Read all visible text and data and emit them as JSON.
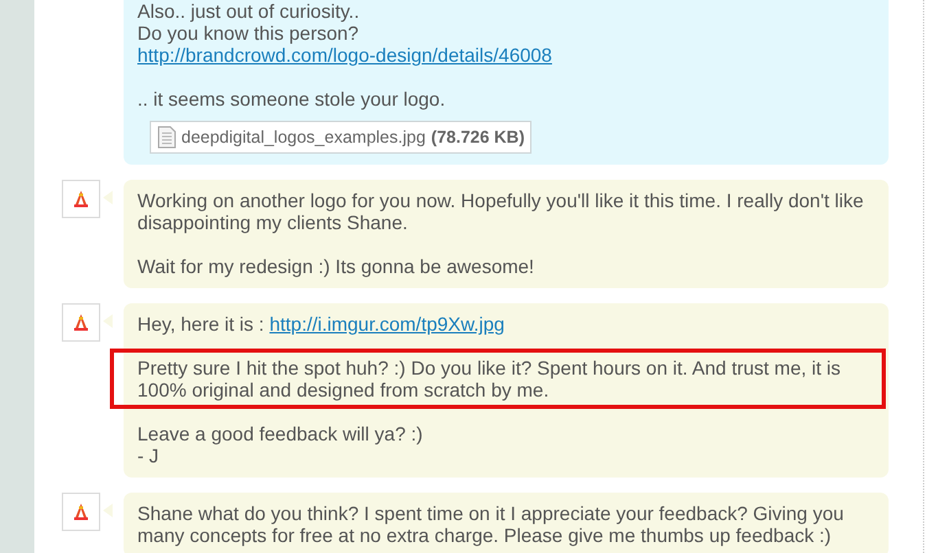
{
  "messages": [
    {
      "kind": "incoming",
      "avatar": false,
      "paragraphs": [
        {
          "highlighted": false,
          "lines": [
            [
              {
                "kind": "text",
                "text": "Also.. just out of curiosity.."
              }
            ],
            [
              {
                "kind": "text",
                "text": "Do you know this person?"
              }
            ],
            [
              {
                "kind": "link",
                "text": "http://brandcrowd.com/logo-design/details/46008"
              }
            ]
          ]
        },
        {
          "highlighted": false,
          "lines": [
            [
              {
                "kind": "text",
                "text": ".. it seems someone stole your logo."
              }
            ]
          ]
        }
      ],
      "attachment": {
        "name": "deepdigital_logos_examples.jpg",
        "size": "(78.726 KB)"
      }
    },
    {
      "kind": "outgoing",
      "avatar": true,
      "paragraphs": [
        {
          "highlighted": false,
          "lines": [
            [
              {
                "kind": "text",
                "text": "Working on another logo for you now. Hopefully you'll like it this time. I really don't like disappointing my clients Shane."
              }
            ]
          ]
        },
        {
          "highlighted": false,
          "lines": [
            [
              {
                "kind": "text",
                "text": "Wait for my redesign :) Its gonna be awesome!"
              }
            ]
          ]
        }
      ]
    },
    {
      "kind": "outgoing",
      "avatar": true,
      "paragraphs": [
        {
          "highlighted": false,
          "lines": [
            [
              {
                "kind": "text",
                "text": "Hey, here it is : "
              },
              {
                "kind": "link",
                "text": "http://i.imgur.com/tp9Xw.jpg"
              }
            ]
          ]
        },
        {
          "highlighted": true,
          "lines": [
            [
              {
                "kind": "text",
                "text": "Pretty sure I hit the spot huh? :) Do you like it? Spent hours on it. And trust me, it is 100% original and designed from scratch by me."
              }
            ]
          ]
        },
        {
          "highlighted": false,
          "lines": [
            [
              {
                "kind": "text",
                "text": "Leave a good feedback will ya? :)"
              }
            ],
            [
              {
                "kind": "text",
                "text": "- J"
              }
            ]
          ]
        }
      ]
    },
    {
      "kind": "outgoing",
      "avatar": true,
      "paragraphs": [
        {
          "highlighted": false,
          "lines": [
            [
              {
                "kind": "text",
                "text": "Shane what do you think? I spent time on it I appreciate your feedback? Giving you many concepts for free at no extra charge. Please give me thumbs up feedback :)"
              }
            ]
          ]
        }
      ]
    }
  ]
}
